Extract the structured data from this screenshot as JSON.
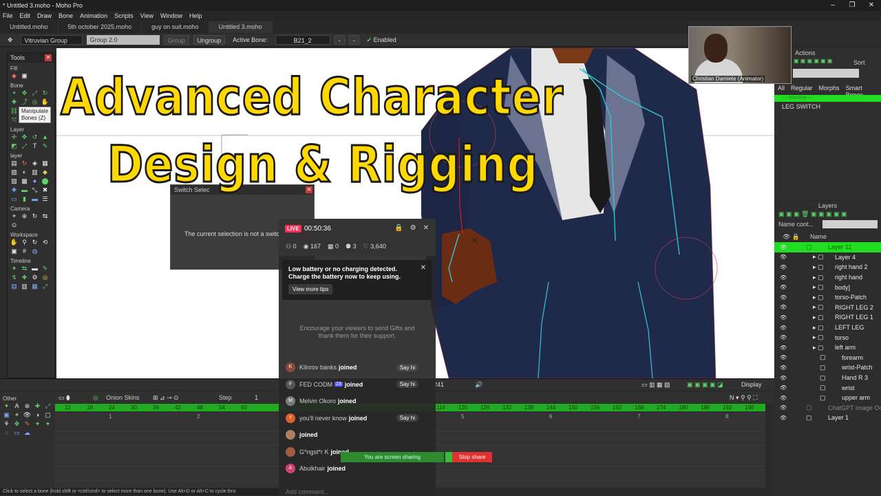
{
  "titlebar": {
    "title": "* Untitled 3.moho - Moho Pro"
  },
  "menu": [
    "File",
    "Edit",
    "Draw",
    "Bone",
    "Animation",
    "Scripts",
    "View",
    "Window",
    "Help"
  ],
  "tabs": [
    "Untitled.moho",
    "5th october 2025.moho",
    "guy on suit.moho",
    "Untitled 3.moho"
  ],
  "options": {
    "group_select": "Vitruvian Group",
    "group_field": "Group 2.0",
    "group_btn": "Group",
    "ungroup_btn": "Ungroup",
    "active_bone_label": "Active Bone:",
    "active_bone": "B21_2",
    "enabled": "Enabled"
  },
  "tools": {
    "title": "Tools",
    "sections": [
      "Fill",
      "Bone",
      "Layer",
      "layer",
      "Camera",
      "Workspace",
      "Timeline",
      "Other"
    ],
    "tooltip_line1": "Manipulate",
    "tooltip_line2": "Bones (Z)"
  },
  "headline": {
    "line1": "Advanced Character",
    "line2": "Design & Rigging"
  },
  "switch_dialog": {
    "title": "Switch Selec",
    "message": "The current selection is not a switch layer."
  },
  "webcam": {
    "caption": "Christian Damiete (Animator)"
  },
  "actions": {
    "title": "Actions",
    "sort": "Sort",
    "tabs": [
      "All",
      "Regular",
      "Morphs",
      "Smart Bones"
    ],
    "rows": [
      "--- Mainline ---",
      "LEG SWITCH"
    ]
  },
  "layers": {
    "title": "Layers",
    "name_filter": "Name cont...",
    "column_name": "Name",
    "items": [
      {
        "name": "Layer 11",
        "indent": 0,
        "selected": true
      },
      {
        "name": "Layer 4",
        "indent": 1
      },
      {
        "name": "right hand 2",
        "indent": 1
      },
      {
        "name": "right hand",
        "indent": 1
      },
      {
        "name": "body]",
        "indent": 1
      },
      {
        "name": "torso-Patch",
        "indent": 1
      },
      {
        "name": "RIGHT LEG 2",
        "indent": 1
      },
      {
        "name": "RIGHT LEG 1",
        "indent": 1
      },
      {
        "name": "LEFT LEG",
        "indent": 1
      },
      {
        "name": "torso",
        "indent": 1
      },
      {
        "name": "left arm",
        "indent": 1
      },
      {
        "name": "forearm",
        "indent": 2
      },
      {
        "name": "wrist-Patch",
        "indent": 2
      },
      {
        "name": "Hand R 3",
        "indent": 2
      },
      {
        "name": "wrist",
        "indent": 2
      },
      {
        "name": "upper arm",
        "indent": 2
      },
      {
        "name": "ChatGPT Image Oct",
        "indent": 0,
        "dim": true
      },
      {
        "name": "Layer 1",
        "indent": 0
      }
    ]
  },
  "timeline": {
    "onion": "Onion Skins",
    "step": "Step",
    "step_val": "1",
    "frame": "241",
    "display": "Display",
    "ruler": [
      "12",
      "18",
      "24",
      "30",
      "36",
      "42",
      "48",
      "54",
      "60",
      "114",
      "120",
      "126",
      "132",
      "138",
      "144",
      "150",
      "156",
      "162",
      "168",
      "174",
      "180",
      "186",
      "192",
      "198"
    ],
    "marks": [
      "1",
      "2",
      "5",
      "6",
      "7",
      "8"
    ]
  },
  "live": {
    "badge": "LIVE",
    "timer": "00:50:36",
    "stats": [
      "0",
      "167",
      "0",
      "3",
      "3,640"
    ],
    "battery_msg": "Low battery or no charging detected. Charge the battery now to keep using.",
    "tips_btn": "View more tips",
    "encourage": "Encourage your viewers to send Gifts and thank them for their support.",
    "feed": [
      {
        "name": "Kilnrov banks",
        "action": "joined",
        "sayhi": "Say hi",
        "color": "#8a4a3a",
        "initial": "K"
      },
      {
        "name": "FED CODM",
        "badge": "23",
        "action": "joined",
        "sayhi": "Say hi",
        "color": "#555",
        "initial": "F"
      },
      {
        "name": "Melvin Okoro",
        "action": "joined",
        "color": "#7a7a7a",
        "initial": "M"
      },
      {
        "name": "you'll never know",
        "action": "joined",
        "sayhi": "Say hi",
        "color": "#e0602a",
        "initial": "Y"
      },
      {
        "name": "",
        "action": "joined",
        "color": "#b08060",
        "initial": ""
      },
      {
        "name": "G*ngst*r K",
        "action": "joined",
        "color": "#a06040",
        "initial": ""
      },
      {
        "name": "Abulkhair",
        "action": "joined",
        "color": "#d04070",
        "initial": "A"
      }
    ],
    "comment_placeholder": "Add comment..."
  },
  "sharebar": {
    "sharing": "You are screen sharing",
    "stop": "Stop share"
  },
  "statusbar": {
    "text": "Click to select a bone (hold shift or <ctrl/cmd> to select more than one bone). Use Alt+D or Alt+C to cycle thro"
  },
  "colors": {
    "accent_green": "#22dd22",
    "headline_yellow": "#ffd800",
    "live_red": "#fe2c55",
    "suit_navy": "#1f2a4a"
  }
}
